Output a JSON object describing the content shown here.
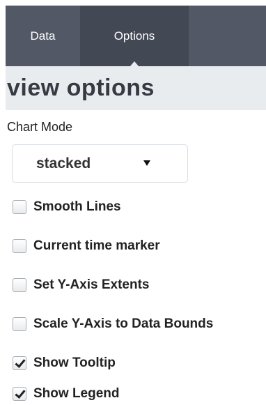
{
  "tabs": [
    {
      "label": "Data",
      "active": false
    },
    {
      "label": "Options",
      "active": true
    }
  ],
  "section": {
    "title": "view options"
  },
  "chart_mode": {
    "label": "Chart Mode",
    "selected": "stacked"
  },
  "options": [
    {
      "label": "Smooth Lines",
      "checked": false
    },
    {
      "label": "Current time marker",
      "checked": false
    },
    {
      "label": "Set Y-Axis Extents",
      "checked": false
    },
    {
      "label": "Scale Y-Axis to Data Bounds",
      "checked": false
    },
    {
      "label": "Show Tooltip",
      "checked": true
    },
    {
      "label": "Show Legend",
      "checked": true
    }
  ],
  "colors": {
    "tab_bar": "#525866",
    "tab_active": "#434855",
    "section_header_bg": "#e9ecef",
    "section_title": "#363a42"
  }
}
